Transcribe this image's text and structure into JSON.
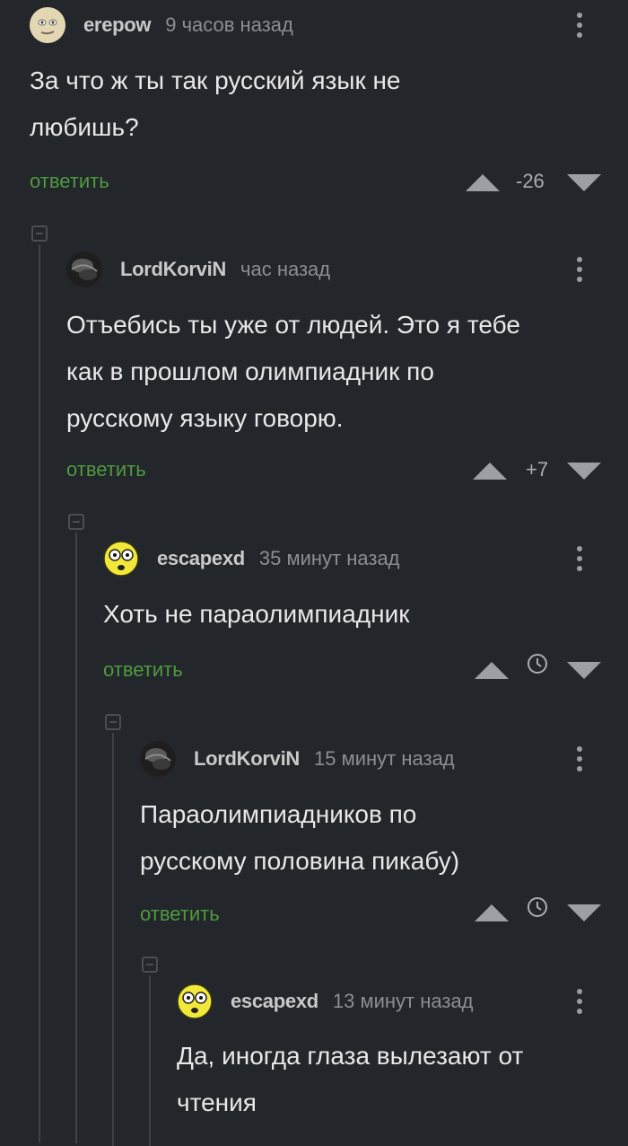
{
  "colors": {
    "background": "#23262b",
    "reply_link": "#4f9a3f",
    "muted_text": "#8b8e92",
    "vote_arrow": "#9c9fa3"
  },
  "comments": [
    {
      "author": "erepow",
      "time": "9 часов назад",
      "text_lines": [
        "За что ж ты так русский язык не",
        "любишь?"
      ],
      "reply_label": "ответить",
      "score": "-26",
      "avatar_icon": "face-avatar-icon"
    },
    {
      "author": "LordKorviN",
      "time": "час назад",
      "text_lines": [
        "Отъебись ты уже от людей. Это я тебе",
        "как в прошлом олимпиадник по",
        "русскому языку говорю."
      ],
      "reply_label": "ответить",
      "score": "+7",
      "avatar_icon": "dark-photo-avatar-icon"
    },
    {
      "author": "escapexd",
      "time": "35 минут назад",
      "text_lines": [
        "Хоть не параолимпиадник"
      ],
      "reply_label": "ответить",
      "score_icon": "clock-icon",
      "avatar_icon": "yellow-face-avatar-icon"
    },
    {
      "author": "LordKorviN",
      "time": "15 минут назад",
      "text_lines": [
        "Параолимпиадников по",
        "русскому половина пикабу)"
      ],
      "reply_label": "ответить",
      "score_icon": "clock-icon",
      "avatar_icon": "dark-photo-avatar-icon"
    },
    {
      "author": "escapexd",
      "time": "13 минут назад",
      "text_lines": [
        "Да, иногда глаза вылезают от",
        "чтения"
      ],
      "avatar_icon": "yellow-face-avatar-icon"
    }
  ]
}
